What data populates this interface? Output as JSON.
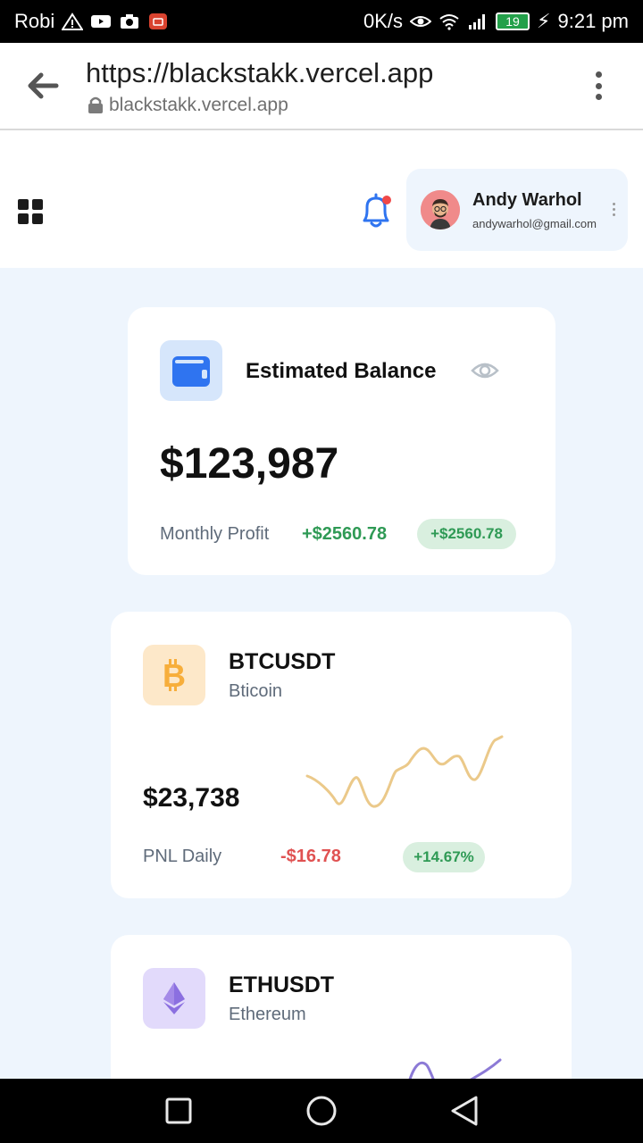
{
  "statusbar": {
    "carrier": "Robi",
    "speed": "0K/s",
    "battery": "19",
    "time": "9:21 pm"
  },
  "browser": {
    "url_title": "https://blackstakk.vercel.app",
    "url_domain": "blackstakk.vercel.app"
  },
  "header": {
    "user_name": "Andy Warhol",
    "user_email": "andywarhol@gmail.com"
  },
  "balance": {
    "title": "Estimated Balance",
    "amount": "$123,987",
    "profit_label": "Monthly Profit",
    "profit_value": "+$2560.78",
    "profit_pill": "+$2560.78"
  },
  "coins": [
    {
      "pair": "BTCUSDT",
      "name": "Bticoin",
      "price": "$23,738",
      "pnl_label": "PNL Daily",
      "pnl_value": "-$16.78",
      "pnl_pill": "+14.67%",
      "icon": "bitcoin-icon",
      "color": "#f7ae3b",
      "spark_color": "#ebc98a"
    },
    {
      "pair": "ETHUSDT",
      "name": "Ethereum",
      "icon": "ethereum-icon",
      "color": "#8b6fe0",
      "spark_color": "#8c7ad6"
    }
  ],
  "colors": {
    "accent_blue": "#2f74f0",
    "positive": "#2f9a55",
    "negative": "#e05252",
    "background": "#eef5fd"
  }
}
